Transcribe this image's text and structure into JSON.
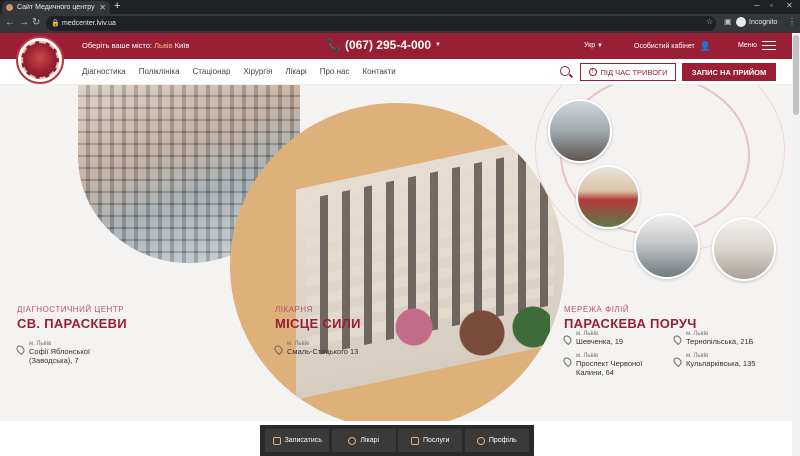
{
  "browser": {
    "tab_title": "Сайт Медичного центру",
    "url": "medcenter.lviv.ua",
    "incognito_label": "Incognito"
  },
  "header": {
    "city_prompt": "Оберіть ваше місто:",
    "city_active": "Львів",
    "city_other": "Київ",
    "phone": "(067) 295-4-000",
    "language": "Укр",
    "cabinet": "Особистий кабінет",
    "menu": "Меню"
  },
  "nav": {
    "links": [
      "Діагностика",
      "Поліклініка",
      "Стаціонар",
      "Хірургія",
      "Лікарі",
      "Про нас",
      "Контакти"
    ],
    "alarm_button": "ПІД ЧАС ТРИВОГИ",
    "appointment_button": "ЗАПИС НА ПРИЙОМ"
  },
  "hero": {
    "diag": {
      "kicker": "ДІАГНОСТИЧНИЙ ЦЕНТР",
      "title": "СВ. ПАРАСКЕВИ",
      "city": "м. Львів",
      "street": "Софії Яблонської (Заводська), 7"
    },
    "hospital": {
      "kicker": "ЛІКАРНЯ",
      "title": "МІСЦЕ СИЛИ",
      "city": "м. Львів",
      "street": "Смаль-Стоцького 13"
    },
    "network": {
      "kicker": "МЕРЕЖА ФІЛІЙ",
      "title": "ПАРАСКЕВА ПОРУЧ",
      "branches": [
        {
          "city": "м. Львів",
          "street": "Шевченка, 19"
        },
        {
          "city": "м. Львів",
          "street": "Тернопільська, 21Б"
        },
        {
          "city": "м. Львів",
          "street": "Проспект Червоної Калини, 64"
        },
        {
          "city": "м. Львів",
          "street": "Кульпарківська, 135"
        }
      ]
    }
  },
  "bottom_bar": {
    "items": [
      "Записатись",
      "Лікарі",
      "Послуги",
      "Профіль"
    ]
  },
  "colors": {
    "brand_crimson": "#9b1f34",
    "accent_gold": "#deb07a",
    "background": "#f5f3f1"
  }
}
